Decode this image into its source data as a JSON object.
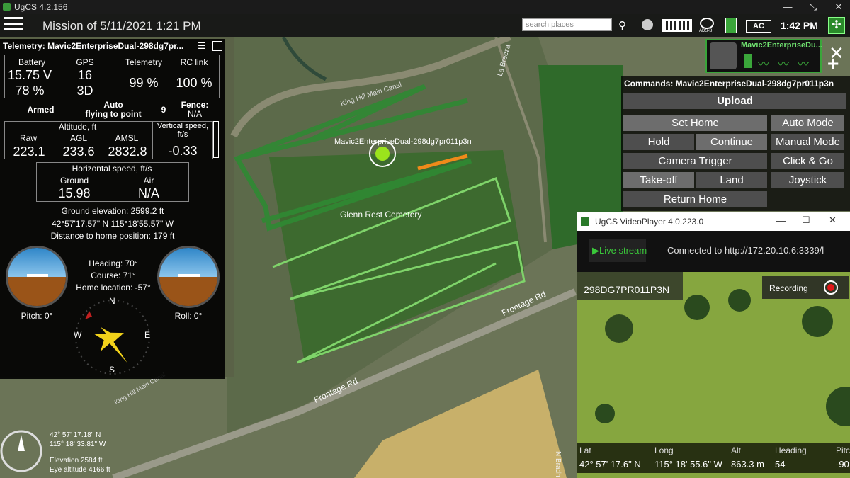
{
  "window": {
    "title": "UgCS 4.2.156"
  },
  "header": {
    "mission_title": "Mission of 5/11/2021 1:21 PM",
    "search_placeholder": "search places",
    "ac_label": "AC",
    "clock": "1:42 PM",
    "adsb_label": "ADS-B"
  },
  "telemetry": {
    "title": "Telemetry: Mavic2EnterpriseDual-298dg7pr...",
    "battery_label": "Battery",
    "battery_voltage": "15.75 V",
    "battery_percent": "78 %",
    "gps_label": "GPS",
    "gps_sats": "16",
    "gps_fix": "3D",
    "telemetry_label": "Telemetry",
    "telemetry_value": "99 %",
    "rc_label": "RC link",
    "rc_value": "100 %",
    "armed": "Armed",
    "mode_line1": "Auto",
    "mode_line2": "flying to point",
    "point_num": "9",
    "fence_label": "Fence:",
    "fence_value": "N/A",
    "altitude_label": "Altitude, ft",
    "raw_label": "Raw",
    "agl_label": "AGL",
    "amsl_label": "AMSL",
    "raw_value": "223.1",
    "agl_value": "233.6",
    "amsl_value": "2832.8",
    "vspeed_label": "Vertical speed, ft/s",
    "vspeed_value": "-0.33",
    "hspeed_label": "Horizontal speed, ft/s",
    "ground_label": "Ground",
    "air_label": "Air",
    "ground_value": "15.98",
    "air_value": "N/A",
    "ground_elev": "Ground elevation: 2599.2 ft",
    "coords": "42°57'17.57\" N  115°18'55.57\" W",
    "home_dist": "Distance to home position: 179 ft",
    "heading": "Heading: 70°",
    "course": "Course: 71°",
    "home_location": "Home location: -57°",
    "pitch": "Pitch: 0°",
    "roll": "Roll: 0°",
    "compass": {
      "n": "N",
      "s": "S",
      "e": "E",
      "w": "W"
    }
  },
  "drone_card": {
    "name": "Mavic2EnterpriseDu..."
  },
  "commands": {
    "title": "Commands: Mavic2EnterpriseDual-298dg7pr011p3n",
    "upload": "Upload",
    "set_home": "Set Home",
    "auto_mode": "Auto Mode",
    "hold": "Hold",
    "continue": "Continue",
    "manual_mode": "Manual Mode",
    "camera_trigger": "Camera Trigger",
    "click_go": "Click & Go",
    "takeoff": "Take-off",
    "land": "Land",
    "joystick": "Joystick",
    "return_home": "Return Home"
  },
  "map": {
    "drone_label": "Mavic2EnterpriseDual-298dg7pr011p3n",
    "cemetery": "Glenn Rest Cemetery",
    "road1": "Frontage Rd",
    "road2": "Frontage Rd",
    "canal": "King Hill Main Canal",
    "canal2": "King Hill Main Canal",
    "labreeza": "La Breeza",
    "nbradh": "N Bradh",
    "coord_lat": "42° 57' 17.18\" N",
    "coord_lon": "115° 18' 33.81\" W",
    "elevation": "Elevation 2584 ft",
    "eye_alt": "Eye altitude 4166 ft"
  },
  "video": {
    "title": "UgCS VideoPlayer 4.0.223.0",
    "live_stream": "Live stream",
    "connected": "Connected to http://172.20.10.6:3339/l",
    "drone_id": "298DG7PR011P3N",
    "recording": "Recording",
    "lat_label": "Lat",
    "long_label": "Long",
    "alt_label": "Alt",
    "heading_label": "Heading",
    "pitch_label": "Pitc",
    "lat_value": "42° 57' 17.6\" N",
    "long_value": "115° 18' 55.6\" W",
    "alt_value": "863.3 m",
    "heading_value": "54",
    "pitch_value": "-90"
  }
}
